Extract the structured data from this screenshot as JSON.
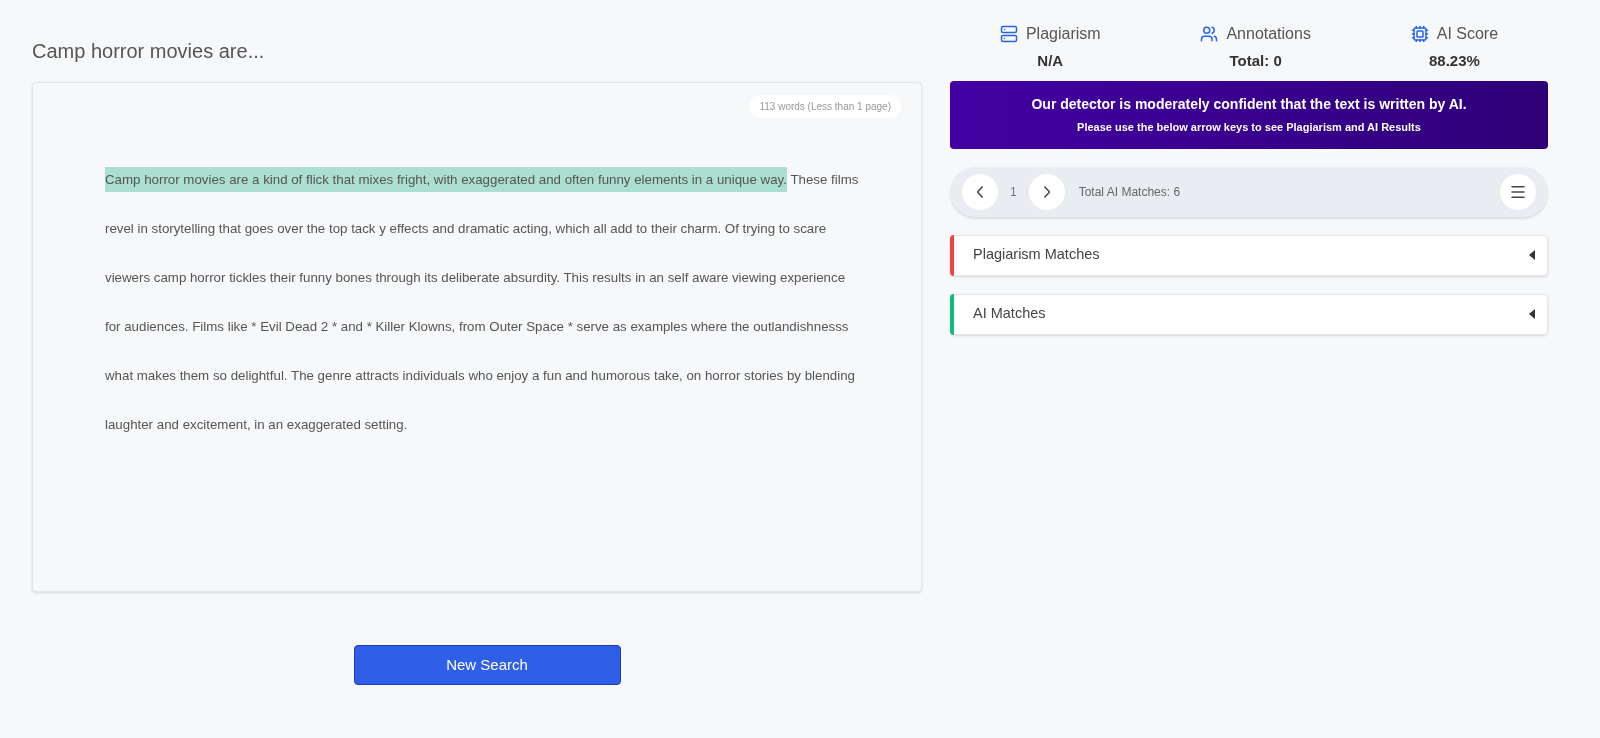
{
  "title": "Camp horror movies are...",
  "document": {
    "word_count": "113 words (Less than 1 page)",
    "segments": [
      {
        "text": "Camp horror movies are a kind of flick that mixes fright, with exaggerated and often funny elements in a unique way.",
        "highlighted": true
      },
      {
        "text": " These films revel in storytelling that goes over the top tack y effects and dramatic acting, which all add to their charm. Of trying to scare viewers camp horror tickles their funny bones through its deliberate absurdity. This results in an self aware viewing experience for audiences. Films like * Evil Dead 2 * and * Killer Klowns, from Outer Space * serve as examples where the outlandishnesss what makes them so delightful. The genre attracts individuals who enjoy a fun and humorous take, on horror stories by blending laughter and excitement, in an exaggerated setting.",
        "highlighted": false
      }
    ]
  },
  "new_search_button": "New Search",
  "stats": [
    {
      "kind": "plagiarism",
      "label": "Plagiarism",
      "value": "N/A"
    },
    {
      "kind": "annotations",
      "label": "Annotations",
      "value": "Total: 0"
    },
    {
      "kind": "ai",
      "label": "AI Score",
      "value": "88.23%"
    }
  ],
  "banner": {
    "headline": "Our detector is moderately confident that the text is written by AI.",
    "subline": "Please use the below arrow keys to see Plagiarism and AI Results"
  },
  "pager": {
    "page": "1",
    "total": "Total AI Matches: 6"
  },
  "sections": [
    {
      "label": "Plagiarism Matches",
      "color": "#ef4444",
      "expanded": false
    },
    {
      "label": "AI Matches",
      "color": "#10b981",
      "expanded": false
    }
  ]
}
